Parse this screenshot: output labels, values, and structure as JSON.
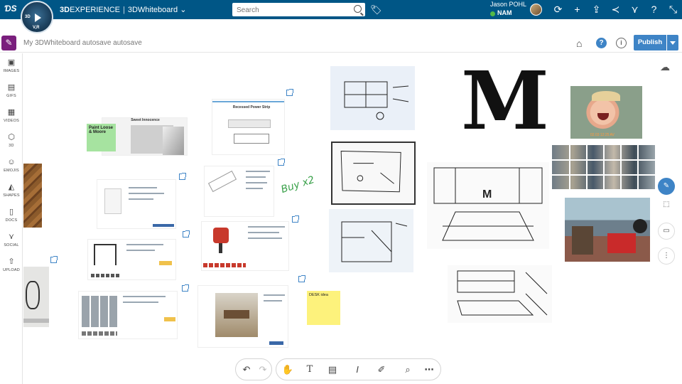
{
  "app": {
    "brand_3d": "3D",
    "brand_rest": "EXPERIENCE",
    "separator": "|",
    "app_name": "3DWhiteboard",
    "compass_labels": [
      "3D",
      "V,R"
    ]
  },
  "search": {
    "placeholder": "Search"
  },
  "user": {
    "name": "Jason POHL",
    "region": "NAM"
  },
  "topbar_icons": [
    "share-icon",
    "plus-icon",
    "broadcast-icon",
    "network-icon",
    "social-icon",
    "help-icon",
    "fullscreen-icon"
  ],
  "header": {
    "title": "My 3DWhiteboard autosave autosave",
    "publish_label": "Publish"
  },
  "left_panel": {
    "items": [
      {
        "label": "IMAGES",
        "icon": "image-icon"
      },
      {
        "label": "GIFS",
        "icon": "gif-icon"
      },
      {
        "label": "VIDEOS",
        "icon": "video-icon"
      },
      {
        "label": "3D",
        "icon": "cube-icon"
      },
      {
        "label": "EMOJIS",
        "icon": "emoji-icon"
      },
      {
        "label": "SHAPES",
        "icon": "shapes-icon"
      },
      {
        "label": "DOCS",
        "icon": "document-icon"
      },
      {
        "label": "SOCIAL",
        "icon": "social-icon"
      },
      {
        "label": "UPLOAD",
        "icon": "upload-icon"
      }
    ]
  },
  "canvas": {
    "big_letter": "M",
    "handwritten_note": "Buy x2",
    "sticky_green": "Paint Loose & Moore",
    "sticky_yellow": "DESK idea",
    "webpage_title": "Sweet Innocence",
    "product_title": "Recessed Power Strip",
    "photo_timestamp": "02.03 12:25 AV"
  },
  "right_rail": [
    "cloud-icon",
    "pen-icon",
    "select-icon",
    "presentation-icon",
    "network-icon"
  ],
  "bottom_toolbar": {
    "history": [
      "undo-icon",
      "redo-icon"
    ],
    "tools": [
      "hand-icon",
      "text-icon",
      "sticky-note-icon",
      "text-style-icon",
      "brush-icon",
      "zoom-icon",
      "more-icon"
    ]
  }
}
